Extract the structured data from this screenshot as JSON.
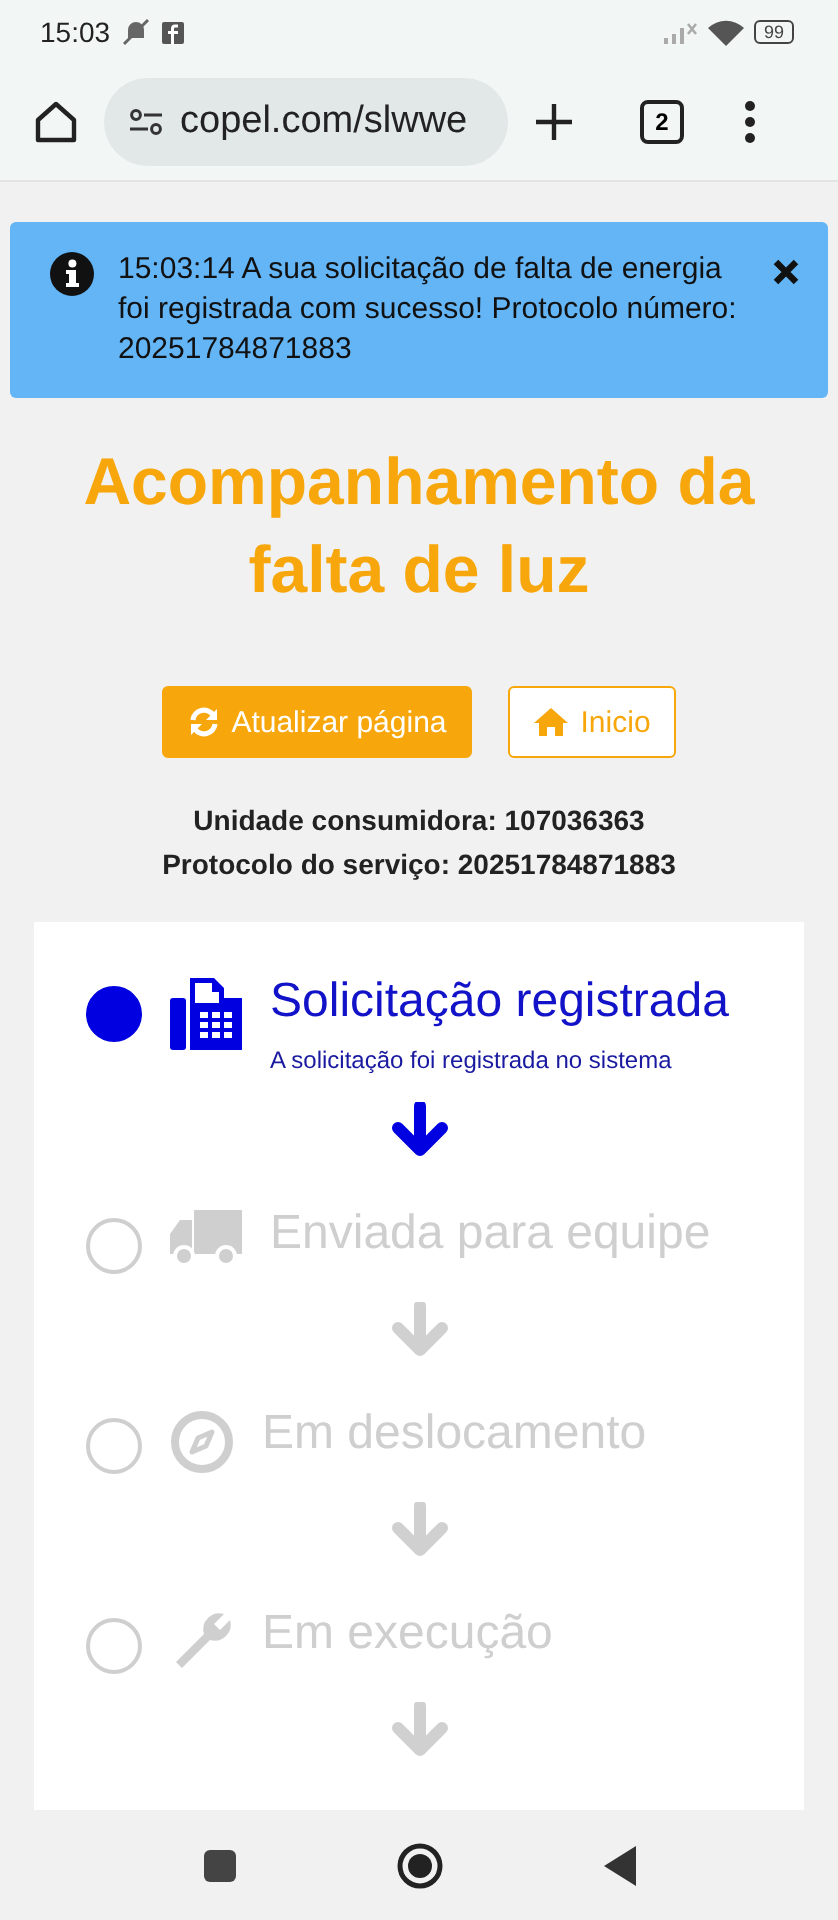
{
  "status_bar": {
    "time": "15:03",
    "battery": "99"
  },
  "browser": {
    "url": "copel.com/slwwe",
    "tab_count": "2"
  },
  "alert": {
    "message": "15:03:14 A sua solicitação de falta de energia foi registrada com sucesso! Protocolo número: 20251784871883"
  },
  "title": "Acompanhamento da falta de luz",
  "buttons": [
    {
      "kind": "primary",
      "label": "Atualizar página"
    },
    {
      "kind": "outline",
      "label": "Inicio"
    }
  ],
  "info": [
    "Unidade consumidora: 107036363",
    "Protocolo do serviço: 20251784871883"
  ],
  "steps": [
    {
      "kind": "fax",
      "title": "Solicitação registrada",
      "description": "A solicitação foi registrada no sistema",
      "done": true
    },
    {
      "kind": "truck",
      "title": "Enviada para equipe",
      "done": false
    },
    {
      "kind": "compass",
      "title": "Em deslocamento",
      "done": false
    },
    {
      "kind": "wrench",
      "title": "Em execução",
      "done": false
    }
  ]
}
